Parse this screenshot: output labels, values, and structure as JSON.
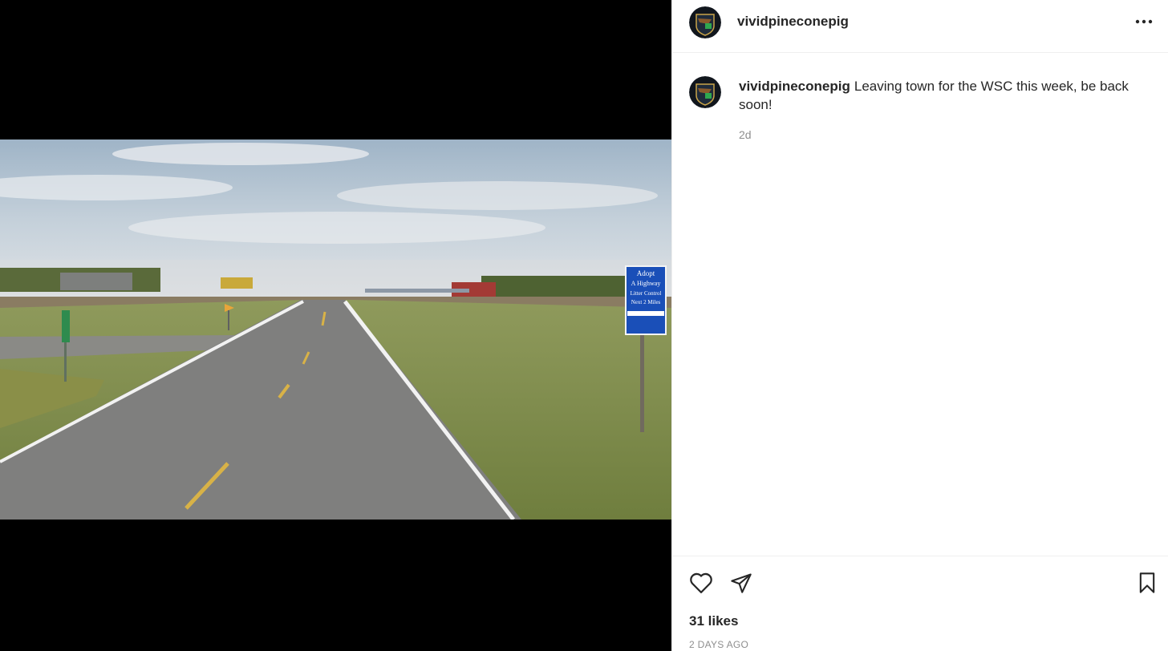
{
  "post": {
    "username": "vividpineconepig",
    "caption": "Leaving town for the WSC this week, be back soon!",
    "comment_time": "2d",
    "likes": "31 likes",
    "post_time": "2 DAYS AGO"
  },
  "photo_sign": {
    "line1": "Adopt",
    "line2": "A Highway",
    "line3": "Litter Control",
    "line4": "Next 2 Miles"
  },
  "icons": {
    "more": "more-horizontal-icon",
    "like": "heart-icon",
    "share": "paper-plane-icon",
    "save": "bookmark-icon"
  },
  "colors": {
    "text": "#262626",
    "secondary": "#8e8e8e",
    "border": "#efefef",
    "sign_blue": "#1a4fb8"
  }
}
